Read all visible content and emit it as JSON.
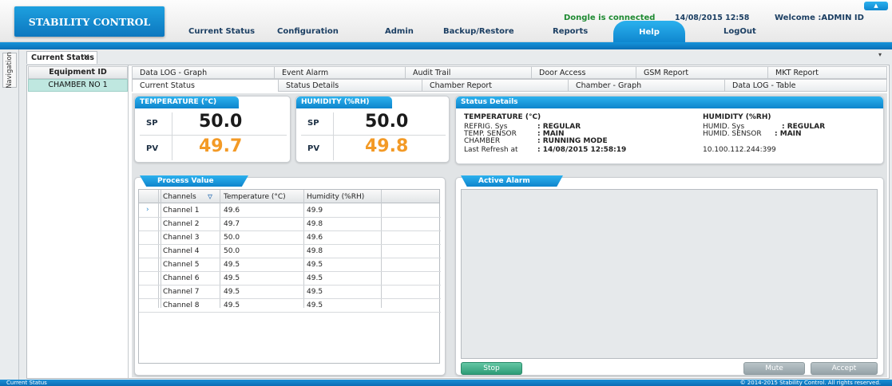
{
  "app": {
    "logo": "STABILITY CONTROL",
    "dongle_status": "Dongle is connected",
    "datetime": "14/08/2015 12:58",
    "welcome": "Welcome :ADMIN ID",
    "collapse_icon": "chevron-up-icon"
  },
  "menu": [
    {
      "label": "Current Status"
    },
    {
      "label": "Configuration"
    },
    {
      "label": "Admin"
    },
    {
      "label": "Backup/Restore"
    },
    {
      "label": "Reports"
    },
    {
      "label": "Help",
      "active": true
    },
    {
      "label": "LogOut"
    }
  ],
  "nav": {
    "label": "Navigation"
  },
  "document_tab": {
    "label": "Current Status",
    "close": "×",
    "arrow": "▾"
  },
  "equipment": {
    "header": "Equipment ID",
    "items": [
      "CHAMBER NO 1"
    ]
  },
  "tabs_row1": [
    "Data LOG - Graph",
    "Event Alarm",
    "Audit Trail",
    "Door Access",
    "GSM Report",
    "MKT Report"
  ],
  "tabs_row2": [
    "Current Status",
    "Status Details",
    "Chamber Report",
    "Chamber - Graph",
    "Data LOG - Table"
  ],
  "active_tab": "Current Status",
  "temperature": {
    "title": "TEMPERATURE (°C)",
    "sp_label": "SP",
    "sp": "50.0",
    "pv_label": "PV",
    "pv": "49.7"
  },
  "humidity": {
    "title": "HUMIDITY (%RH)",
    "sp_label": "SP",
    "sp": "50.0",
    "pv_label": "PV",
    "pv": "49.8"
  },
  "status_details": {
    "title": "Status Details",
    "temp_header": "TEMPERATURE (°C)",
    "humid_header": "HUMIDITY (%RH)",
    "refrig_label": "REFRIG. Sys",
    "refrig_value": ": REGULAR",
    "temp_sensor_label": "TEMP. SENSOR",
    "temp_sensor_value": ": MAIN",
    "chamber_label": "CHAMBER",
    "chamber_value": ": RUNNING MODE",
    "refresh_label": "Last Refresh at",
    "refresh_value": ": 14/08/2015 12:58:19",
    "humid_sys_label": "HUMID. Sys",
    "humid_sys_value": ": REGULAR",
    "humid_sensor_label": "HUMID. SENSOR",
    "humid_sensor_value": ": MAIN",
    "ip": "10.100.112.244:399"
  },
  "process_value": {
    "title": "Process Value",
    "columns": [
      "Channels",
      "Temperature (°C)",
      "Humidity (%RH)"
    ],
    "filter_icon": "filter-icon",
    "rows": [
      {
        "channel": "Channel 1",
        "temp": "49.6",
        "humid": "49.9",
        "selected": true
      },
      {
        "channel": "Channel 2",
        "temp": "49.7",
        "humid": "49.8"
      },
      {
        "channel": "Channel 3",
        "temp": "50.0",
        "humid": "49.6"
      },
      {
        "channel": "Channel 4",
        "temp": "50.0",
        "humid": "49.8"
      },
      {
        "channel": "Channel 5",
        "temp": "49.5",
        "humid": "49.5"
      },
      {
        "channel": "Channel 6",
        "temp": "49.5",
        "humid": "49.5"
      },
      {
        "channel": "Channel 7",
        "temp": "49.5",
        "humid": "49.5"
      },
      {
        "channel": "Channel 8",
        "temp": "49.5",
        "humid": "49.5"
      }
    ]
  },
  "active_alarm": {
    "title": "Active Alarm",
    "stop": "Stop",
    "mute": "Mute",
    "accept": "Accept"
  },
  "status_bar": {
    "left": "Current Status",
    "right": "© 2014-2015 Stability Control. All rights reserved."
  },
  "colors": {
    "accent": "#0e84cc",
    "pv": "#f39a26",
    "dongle": "#1e8a32",
    "selected_row": "#bfe7e0"
  }
}
